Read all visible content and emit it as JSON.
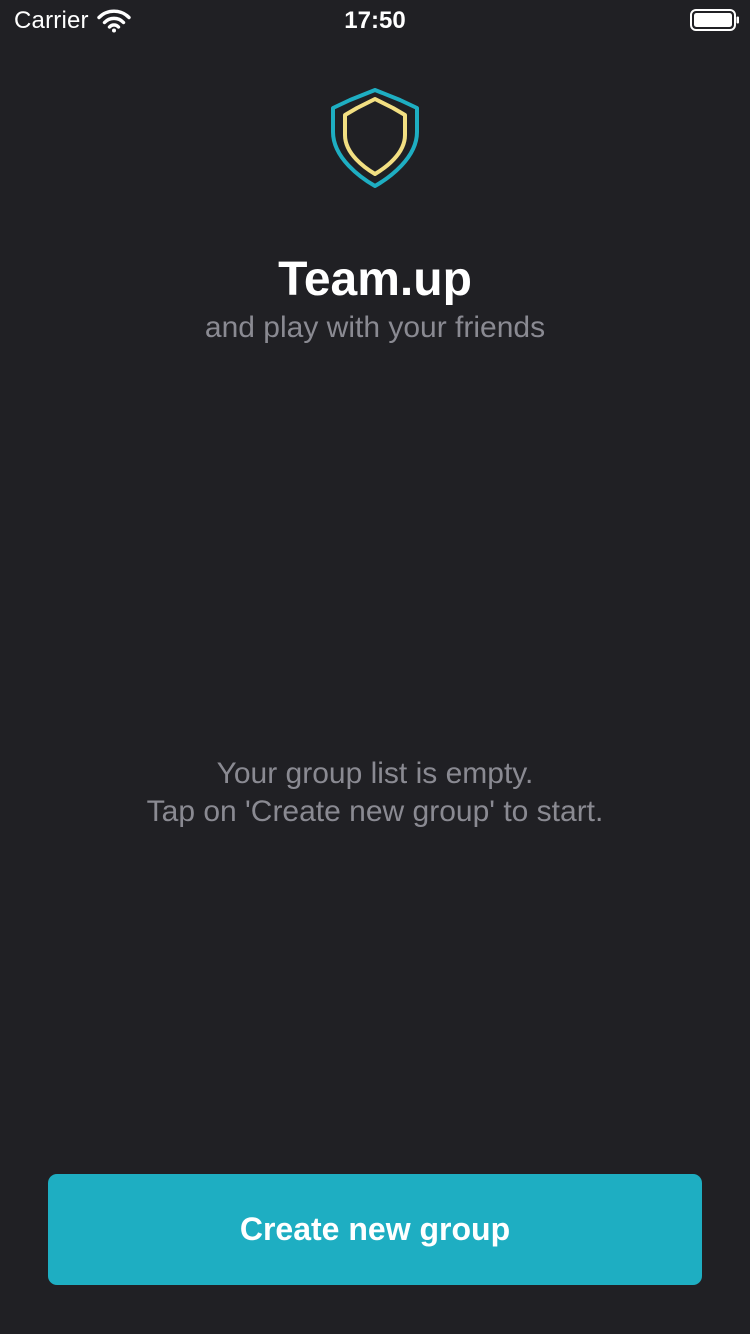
{
  "status_bar": {
    "carrier": "Carrier",
    "time": "17:50",
    "wifi_icon": "wifi-icon",
    "battery_icon": "battery-icon",
    "battery_level": 1.0
  },
  "header": {
    "logo_icon": "shield-icon",
    "title": "Team.up",
    "subtitle": "and play with your friends"
  },
  "empty_state": {
    "line1": "Your group list is empty.",
    "line2": "Tap on 'Create new group' to start."
  },
  "actions": {
    "create_group_label": "Create new group"
  },
  "colors": {
    "background": "#202024",
    "accent": "#1eaec2",
    "shield_outer": "#1eaec2",
    "shield_inner": "#f2df82",
    "text_muted": "#8a8a92"
  }
}
